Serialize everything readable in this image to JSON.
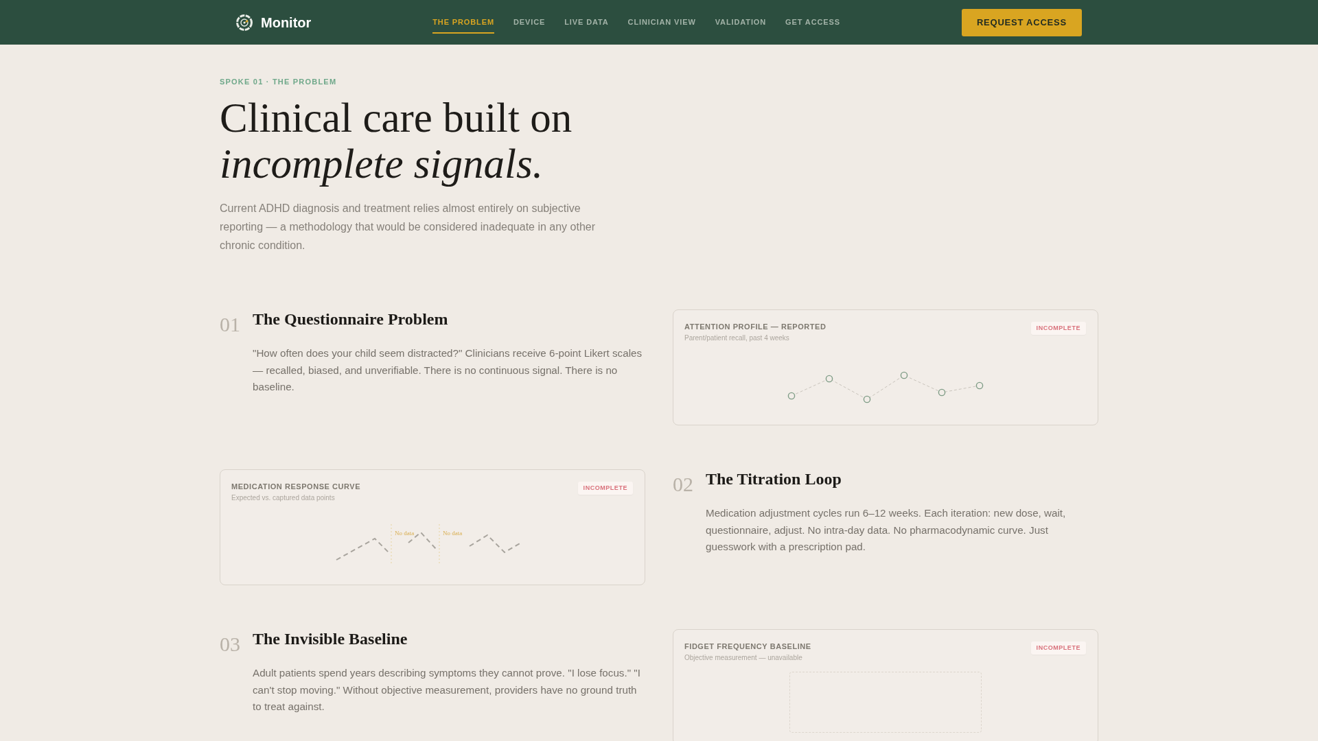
{
  "nav": {
    "logo": "Monitor",
    "links": [
      {
        "label": "THE PROBLEM",
        "selected": true
      },
      {
        "label": "DEVICE",
        "selected": false
      },
      {
        "label": "LIVE DATA",
        "selected": false
      },
      {
        "label": "CLINICIAN VIEW",
        "selected": false
      },
      {
        "label": "VALIDATION",
        "selected": false
      },
      {
        "label": "GET ACCESS",
        "selected": false
      }
    ],
    "button": "REQUEST ACCESS"
  },
  "hero": {
    "eyebrow": "SPOKE 01 · THE PROBLEM",
    "title": "Clinical care built on *incomplete signals.*",
    "lead": "Current ADHD diagnosis and treatment relies almost entirely on subjective reporting — a methodology that would be considered inadequate in any other chronic condition."
  },
  "rows": [
    {
      "items": [
        {
          "kind": "point",
          "number": "01",
          "title": "The Questionnaire Problem",
          "body": "\"How often does your child seem distracted?\" Clinicians receive 6-point Likert scales — recalled, biased, and unverifiable. There is no continuous signal. There is no baseline."
        },
        {
          "kind": "card",
          "title": "ATTENTION PROFILE — REPORTED",
          "subtitle": "Parent/patient recall, past 4 weeks",
          "badge": "INCOMPLETE",
          "visual": {
            "kind": "dots"
          }
        }
      ]
    },
    {
      "items": [
        {
          "kind": "card",
          "title": "MEDICATION RESPONSE CURVE",
          "subtitle": "Expected vs. captured data points",
          "badge": "INCOMPLETE",
          "visual": {
            "kind": "gaps",
            "gap_labels": [
              "No data",
              "No data"
            ]
          }
        },
        {
          "kind": "point",
          "number": "02",
          "title": "The Titration Loop",
          "body": "Medication adjustment cycles run 6–12 weeks. Each iteration: new dose, wait, questionnaire, adjust. No intra-day data. No pharmacodynamic curve. Just guesswork with a prescription pad."
        }
      ]
    },
    {
      "items": [
        {
          "kind": "point",
          "number": "03",
          "title": "The Invisible Baseline",
          "body": "Adult patients spend years describing symptoms they cannot prove. \"I lose focus.\" \"I can't stop moving.\" Without objective measurement, providers have no ground truth to treat against."
        },
        {
          "kind": "card",
          "title": "FIDGET FREQUENCY BASELINE",
          "subtitle": "Objective measurement — unavailable",
          "badge": "INCOMPLETE",
          "visual": {
            "kind": "empty"
          }
        }
      ]
    }
  ]
}
